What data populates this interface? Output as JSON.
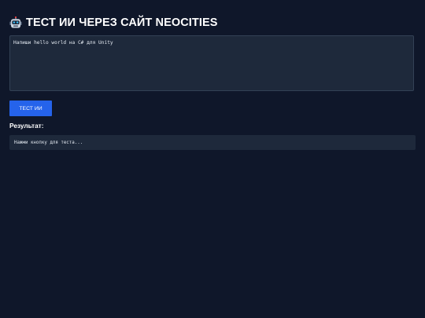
{
  "header": {
    "icon": "robot-icon",
    "title": "ТЕСТ ИИ ЧЕРЕЗ САЙТ NEOCITIES"
  },
  "prompt": {
    "value": "Напиши hello world на C# для Unity"
  },
  "actions": {
    "test_label": "ТЕСТ ИИ"
  },
  "result": {
    "label": "Результат:",
    "text": "Нажми кнопку для теста..."
  },
  "colors": {
    "background": "#0f172a",
    "panel": "#1e293b",
    "accent": "#2563eb",
    "text": "#ffffff"
  }
}
